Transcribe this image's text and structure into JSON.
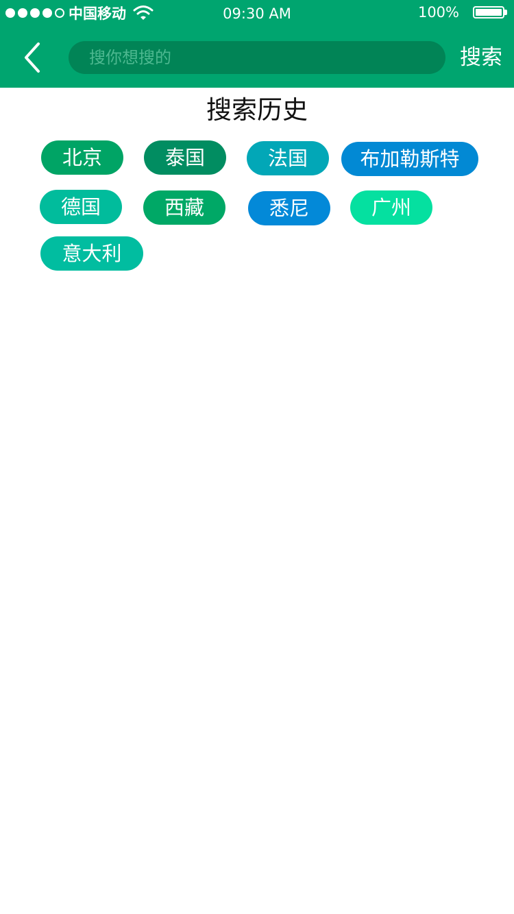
{
  "status_bar": {
    "carrier": "中国移动",
    "time": "09:30 AM",
    "battery": "100%",
    "battery_level": 1.0,
    "signal_bars": [
      true,
      true,
      true,
      true,
      false
    ]
  },
  "header": {
    "back_icon": "chevron-left-icon",
    "search_placeholder": "搜你想搜的",
    "search_value": "",
    "search_button": "搜索",
    "background_color": "#00a56f"
  },
  "history": {
    "title": "搜索历史",
    "tags": [
      {
        "label": "北京",
        "color": "#00a465"
      },
      {
        "label": "泰国",
        "color": "#018d61"
      },
      {
        "label": "法国",
        "color": "#02a7b7"
      },
      {
        "label": "布加勒斯特",
        "color": "#0289d4"
      },
      {
        "label": "德国",
        "color": "#01bc9c"
      },
      {
        "label": "西藏",
        "color": "#00a866"
      },
      {
        "label": "悉尼",
        "color": "#0389d8"
      },
      {
        "label": "广州",
        "color": "#05e0a0"
      },
      {
        "label": "意大利",
        "color": "#01bda0"
      }
    ]
  }
}
